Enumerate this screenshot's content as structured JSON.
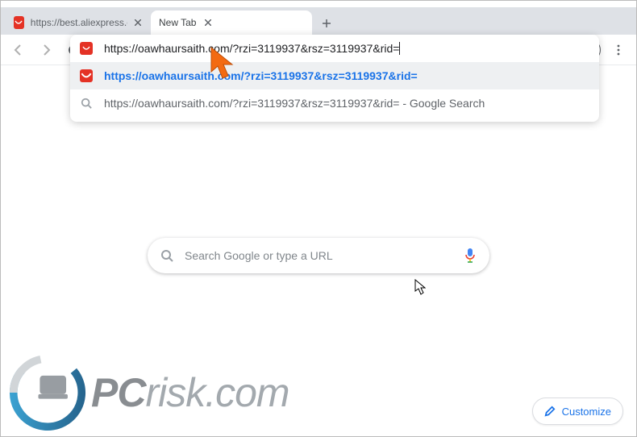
{
  "window": {
    "tabs": [
      {
        "title": "https://best.aliexpress.com/?cv=",
        "active": false
      },
      {
        "title": "New Tab",
        "active": true
      }
    ]
  },
  "toolbar": {
    "address_value": "https://oawhaursaith.com/?rzi=3119937&rsz=3119937&rid="
  },
  "suggestions": [
    {
      "selected": true,
      "icon": "site",
      "text": "https://oawhaursaith.com/?rzi=3119937&rsz=3119937&rid="
    },
    {
      "selected": false,
      "icon": "search",
      "text": "https://oawhaursaith.com/?rzi=3119937&rsz=3119937&rid= - Google Search"
    }
  ],
  "newtab": {
    "search_placeholder": "Search Google or type a URL",
    "customize_label": "Customize"
  },
  "watermark": {
    "brand_prefix": "PC",
    "brand_rest": "risk.com"
  }
}
